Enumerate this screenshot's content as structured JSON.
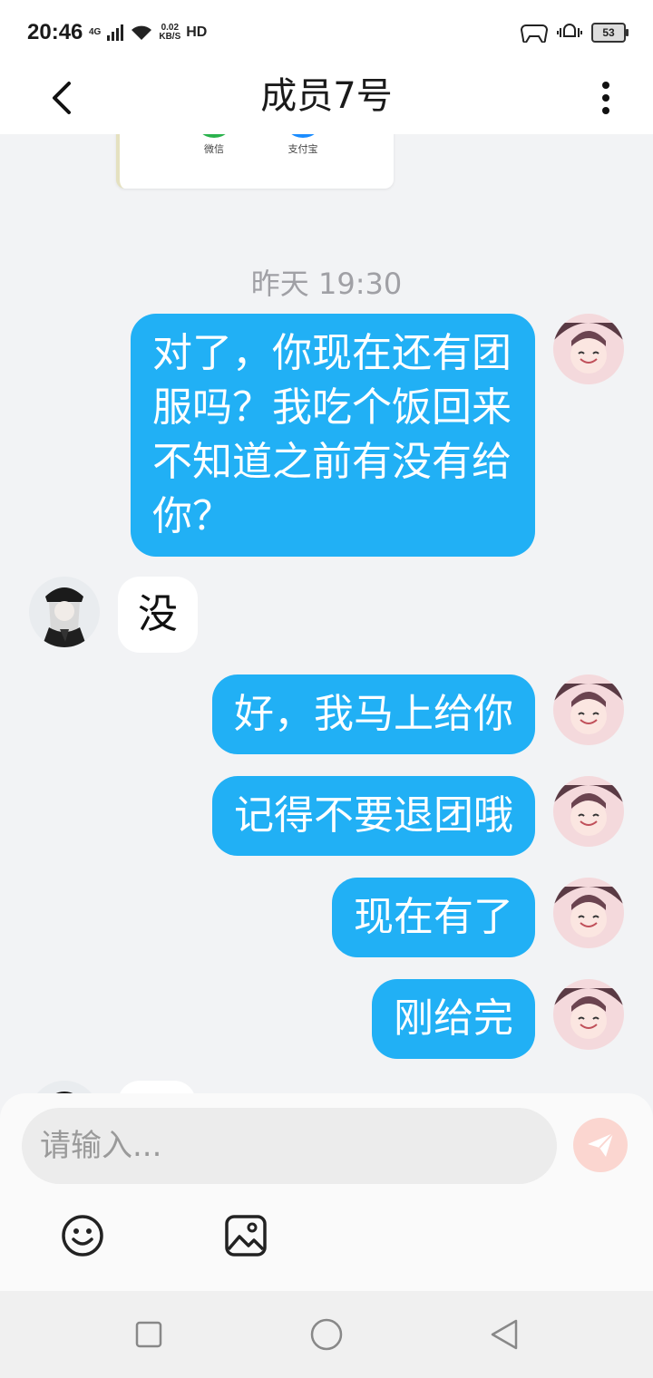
{
  "status": {
    "time": "20:46",
    "network": "4G",
    "speed_top": "0.02",
    "speed_bottom": "KB/S",
    "hd": "HD",
    "battery": "53"
  },
  "header": {
    "title": "成员7号"
  },
  "card": {
    "wechat": "微信",
    "alipay": "支付宝"
  },
  "timestamp": "昨天 19:30",
  "messages": [
    {
      "from": "me",
      "text": "对了，你现在还有团服吗？我吃个饭回来不知道之前有没有给你？"
    },
    {
      "from": "them",
      "text": "没"
    },
    {
      "from": "me",
      "text": "好，我马上给你"
    },
    {
      "from": "me",
      "text": "记得不要退团哦"
    },
    {
      "from": "me",
      "text": "现在有了"
    },
    {
      "from": "me",
      "text": "刚给完"
    }
  ],
  "input": {
    "placeholder": "请输入..."
  },
  "colors": {
    "bubble_me": "#21b0f5",
    "bubble_them": "#ffffff",
    "send": "#fbd6d0",
    "background": "#f2f3f5"
  },
  "icons": [
    "back-arrow-icon",
    "more-vertical-icon",
    "wechat-pay-icon",
    "alipay-icon",
    "send-icon",
    "emoji-icon",
    "image-icon",
    "recent-apps-icon",
    "home-icon",
    "back-triangle-icon"
  ]
}
